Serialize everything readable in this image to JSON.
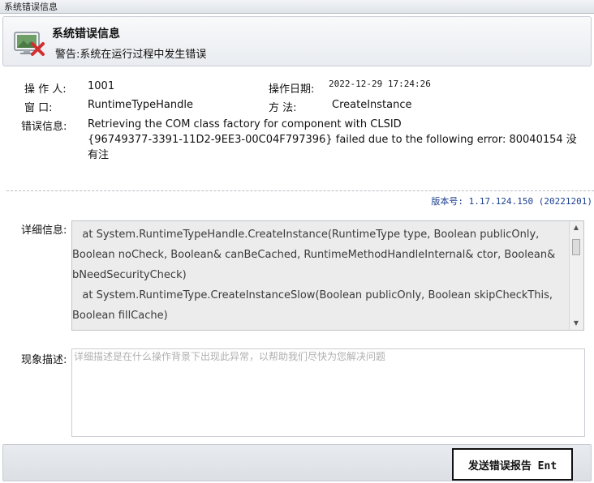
{
  "window": {
    "title": "系统错误信息"
  },
  "header": {
    "title": "系统错误信息",
    "subtitle": "警告:系统在运行过程中发生错误",
    "icon": "monitor-error-icon"
  },
  "info": {
    "operator_label": "操 作 人:",
    "operator_value": "1001",
    "date_label": "操作日期:",
    "date_value": "2022-12-29 17:24:26",
    "window_label": "窗     口:",
    "window_value": "RuntimeTypeHandle",
    "method_label": "方     法:",
    "method_value": "CreateInstance",
    "error_label": "错误信息:",
    "error_value": "Retrieving the COM class factory for component with CLSID\n{96749377-3391-11D2-9EE3-00C04F797396} failed due to the following error: 80040154 没有注"
  },
  "version": "版本号: 1.17.124.150 (20221201)",
  "detail": {
    "label": "详细信息:",
    "text": "   at System.RuntimeTypeHandle.CreateInstance(RuntimeType type, Boolean publicOnly, Boolean noCheck, Boolean& canBeCached, RuntimeMethodHandleInternal& ctor, Boolean& bNeedSecurityCheck)\n   at System.RuntimeType.CreateInstanceSlow(Boolean publicOnly, Boolean skipCheckThis, Boolean fillCache)"
  },
  "description": {
    "label": "现象描述:",
    "placeholder": "详细描述是在什么操作背景下出现此异常，以帮助我们尽快为您解决问题",
    "value": ""
  },
  "footer": {
    "send_button": "发送错误报告 Ent"
  },
  "colors": {
    "version_text": "#1b3f8f",
    "detail_bg": "#ececec",
    "error_icon": "#d12f2f"
  }
}
